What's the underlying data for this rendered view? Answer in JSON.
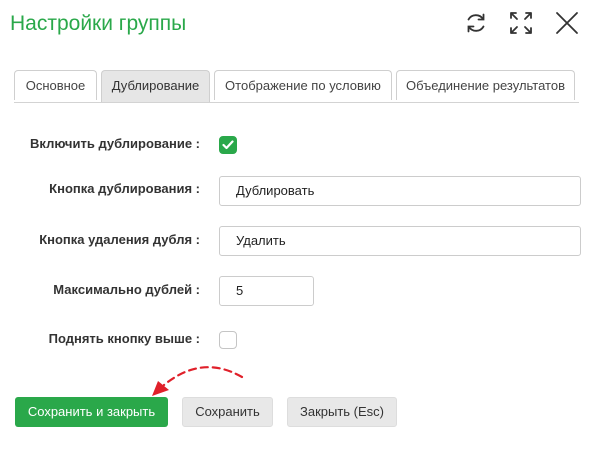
{
  "dialog": {
    "title": "Настройки группы"
  },
  "header_icons": [
    "refresh-icon",
    "fullscreen-icon",
    "close-icon"
  ],
  "tabs": [
    {
      "label": "Основное",
      "active": false
    },
    {
      "label": "Дублирование",
      "active": true
    },
    {
      "label": "Отображение по условию",
      "active": false
    },
    {
      "label": "Объединение результатов",
      "active": false
    }
  ],
  "form": {
    "enable_duplication": {
      "label": "Включить дублирование :",
      "checked": true
    },
    "duplicate_button": {
      "label": "Кнопка дублирования :",
      "value": "Дублировать"
    },
    "delete_duplicate_button": {
      "label": "Кнопка удаления дубля :",
      "value": "Удалить"
    },
    "max_duplicates": {
      "label": "Максимально дублей :",
      "value": "5"
    },
    "raise_button": {
      "label": "Поднять кнопку выше :",
      "checked": false
    }
  },
  "footer": {
    "save_close": "Сохранить и закрыть",
    "save": "Сохранить",
    "close": "Закрыть (Esc)"
  },
  "colors": {
    "accent": "#2aa84a",
    "annotation_arrow": "#e0202a"
  }
}
